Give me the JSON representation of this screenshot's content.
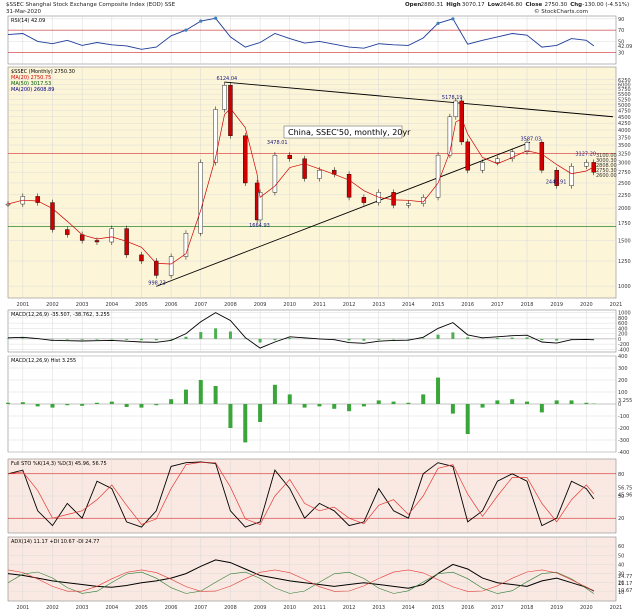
{
  "header": {
    "symbol": "$SSEC Shanghai Stock Exchange Composite Index (EOD) SSE",
    "date": "31-Mar-2020",
    "ohlc": [
      {
        "k": "Open",
        "v": "2880.31"
      },
      {
        "k": "High",
        "v": "3070.17"
      },
      {
        "k": "Low",
        "v": "2646.80"
      },
      {
        "k": "Close",
        "v": "2750.30"
      },
      {
        "k": "Chg",
        "v": "-130.00 (-4.51%)"
      }
    ],
    "brand": "© StockCharts.com"
  },
  "chart_data": [
    {
      "type": "line",
      "panel": "rsi",
      "legend": "RSI(14) 42.09",
      "ylim": [
        10,
        95
      ],
      "ticks": [
        30,
        50,
        70,
        90
      ],
      "last_label": "42.09",
      "x": [
        2000.5,
        2001,
        2001.5,
        2002,
        2002.5,
        2003,
        2003.5,
        2004,
        2004.5,
        2005,
        2005.5,
        2006,
        2006.5,
        2007,
        2007.5,
        2008,
        2008.5,
        2009,
        2009.5,
        2010,
        2010.5,
        2011,
        2011.5,
        2012,
        2012.5,
        2013,
        2013.5,
        2014,
        2014.5,
        2015,
        2015.5,
        2016,
        2016.5,
        2017,
        2017.5,
        2018,
        2018.5,
        2019,
        2019.5,
        2020,
        2020.25
      ],
      "values": [
        62,
        64,
        50,
        46,
        52,
        43,
        48,
        44,
        42,
        36,
        40,
        60,
        70,
        86,
        91,
        58,
        40,
        48,
        64,
        55,
        47,
        50,
        45,
        40,
        38,
        46,
        44,
        43,
        56,
        82,
        90,
        45,
        52,
        58,
        64,
        61,
        40,
        43,
        55,
        52,
        42
      ]
    },
    {
      "type": "bar",
      "panel": "price",
      "legend": "$SSEC (Monthly) 2750.30",
      "subtitle": "China, SSEC'50, monthly, 20yr",
      "scale": "log",
      "ylim": [
        900,
        7000
      ],
      "ticks": [
        1000,
        1250,
        1500,
        1750,
        2000,
        2250,
        2500,
        2750,
        3000,
        3250,
        3500,
        3750,
        4000,
        4250,
        4500,
        4750,
        5000,
        5250,
        5500,
        5750,
        6000,
        6250
      ],
      "x_ticks": [
        "2001",
        "2002",
        "2003",
        "2004",
        "2005",
        "2006",
        "2007",
        "2008",
        "2009",
        "2010",
        "2011",
        "2012",
        "2013",
        "2014",
        "2015",
        "2016",
        "2017",
        "2018",
        "2019",
        "2020",
        "2021"
      ],
      "legend_lines": [
        {
          "text": "MA(20) 2750.75",
          "color": "#d00000"
        },
        {
          "text": "MA(50) 3017.53",
          "color": "#006000"
        },
        {
          "text": "MA(200) 2608.89",
          "color": "#000080"
        }
      ],
      "x": [
        2000.5,
        2001,
        2001.5,
        2002,
        2002.5,
        2003,
        2003.5,
        2004,
        2004.5,
        2005,
        2005.5,
        2006,
        2006.5,
        2007,
        2007.5,
        2007.8,
        2008,
        2008.5,
        2008.9,
        2009,
        2009.5,
        2010,
        2010.5,
        2011,
        2011.5,
        2012,
        2012.5,
        2013,
        2013.5,
        2014,
        2014.5,
        2015,
        2015.4,
        2015.6,
        2015.8,
        2016,
        2016.5,
        2017,
        2017.5,
        2018,
        2018.5,
        2019,
        2019.5,
        2020,
        2020.25
      ],
      "values": [
        2073,
        2218,
        2100,
        1653,
        1580,
        1500,
        1480,
        1667,
        1320,
        1250,
        1100,
        1300,
        1600,
        3000,
        4800,
        5954,
        3800,
        2500,
        1800,
        2300,
        3200,
        3100,
        2600,
        2800,
        2700,
        2200,
        2100,
        2300,
        2050,
        2080,
        2200,
        3200,
        4500,
        5178,
        3600,
        2800,
        3000,
        3100,
        3300,
        3587,
        2800,
        2440,
        2900,
        3000,
        2750
      ],
      "annotations": [
        {
          "x": 2007.8,
          "y": 6124,
          "text": "6124.04"
        },
        {
          "x": 2015.4,
          "y": 5178,
          "text": "5178.19"
        },
        {
          "x": 2009.5,
          "y": 3478,
          "text": "3478.01"
        },
        {
          "x": 2018.05,
          "y": 3587,
          "text": "3587.03"
        },
        {
          "x": 2019.9,
          "y": 3127,
          "text": "3127.20"
        },
        {
          "x": 2005.5,
          "y": 998,
          "text": "998.23"
        },
        {
          "x": 2008.9,
          "y": 1664,
          "text": "1664.93"
        },
        {
          "x": 2018.9,
          "y": 2440,
          "text": "2440.91"
        }
      ],
      "price_labels": [
        "3100.00",
        "3000.30",
        "2808.00",
        "2750.30",
        "2600.00"
      ]
    },
    {
      "type": "line",
      "panel": "macd",
      "legend": "MACD(12,26,9) -35.507, -38.762, 3.255",
      "ylim": [
        -500,
        1100
      ],
      "ticks": [
        -400,
        -200,
        0,
        200,
        400,
        600,
        800,
        1000
      ],
      "x": [
        2000.5,
        2001,
        2001.5,
        2002,
        2002.5,
        2003,
        2003.5,
        2004,
        2004.5,
        2005,
        2005.5,
        2006,
        2006.5,
        2007,
        2007.5,
        2008,
        2008.5,
        2009,
        2009.5,
        2010,
        2010.5,
        2011,
        2011.5,
        2012,
        2012.5,
        2013,
        2013.5,
        2014,
        2014.5,
        2015,
        2015.5,
        2016,
        2016.5,
        2017,
        2017.5,
        2018,
        2018.5,
        2019,
        2019.5,
        2020,
        2020.25
      ],
      "values": [
        40,
        60,
        10,
        -60,
        -70,
        -80,
        -70,
        -60,
        -90,
        -120,
        -130,
        -60,
        200,
        650,
        1000,
        700,
        50,
        -350,
        -120,
        80,
        40,
        0,
        -30,
        -140,
        -170,
        -90,
        -60,
        -50,
        60,
        400,
        620,
        150,
        40,
        80,
        120,
        140,
        -120,
        -160,
        -30,
        -20,
        -35
      ]
    },
    {
      "type": "bar",
      "panel": "macd_hist",
      "legend": "MACD(12,26,9) Hist 3.255",
      "ylim": [
        -400,
        400
      ],
      "ticks": [
        -400,
        -300,
        -200,
        -100,
        0,
        100,
        200,
        300,
        400
      ],
      "last_label": "3.255",
      "x": [
        2000.5,
        2001,
        2001.5,
        2002,
        2002.5,
        2003,
        2003.5,
        2004,
        2004.5,
        2005,
        2005.5,
        2006,
        2006.5,
        2007,
        2007.5,
        2008,
        2008.5,
        2009,
        2009.5,
        2010,
        2010.5,
        2011,
        2011.5,
        2012,
        2012.5,
        2013,
        2013.5,
        2014,
        2014.5,
        2015,
        2015.5,
        2016,
        2016.5,
        2017,
        2017.5,
        2018,
        2018.5,
        2019,
        2019.5,
        2020,
        2020.25
      ],
      "values": [
        10,
        15,
        -20,
        -30,
        -10,
        -15,
        10,
        20,
        -25,
        -30,
        -10,
        40,
        120,
        200,
        150,
        -200,
        -320,
        -150,
        160,
        80,
        -30,
        -20,
        -40,
        -60,
        -20,
        30,
        20,
        10,
        80,
        220,
        -80,
        -250,
        -30,
        30,
        40,
        20,
        -70,
        30,
        30,
        10,
        3
      ]
    },
    {
      "type": "line",
      "panel": "stoch",
      "legend": "Full STO %K(14,3) %D(3) 45.96, 56.75",
      "ylim": [
        0,
        100
      ],
      "ticks": [
        20,
        50,
        80
      ],
      "last_labels": [
        "56.75",
        "45.96"
      ],
      "x": [
        2000.5,
        2001,
        2001.5,
        2002,
        2002.5,
        2003,
        2003.5,
        2004,
        2004.5,
        2005,
        2005.5,
        2006,
        2006.5,
        2007,
        2007.5,
        2008,
        2008.5,
        2009,
        2009.5,
        2010,
        2010.5,
        2011,
        2011.5,
        2012,
        2012.5,
        2013,
        2013.5,
        2014,
        2014.5,
        2015,
        2015.5,
        2016,
        2016.5,
        2017,
        2017.5,
        2018,
        2018.5,
        2019,
        2019.5,
        2020,
        2020.25
      ],
      "values": [
        80,
        85,
        30,
        10,
        40,
        20,
        70,
        60,
        15,
        8,
        30,
        90,
        95,
        96,
        94,
        30,
        8,
        15,
        85,
        60,
        20,
        40,
        30,
        10,
        15,
        60,
        30,
        20,
        80,
        95,
        90,
        15,
        30,
        70,
        80,
        70,
        10,
        20,
        70,
        60,
        46
      ]
    },
    {
      "type": "line",
      "panel": "adx",
      "legend": "ADX(14) 11.17 +DI 10.67 -DI 24.77",
      "ylim": [
        0,
        70
      ],
      "ticks": [
        10,
        20,
        30,
        40,
        50,
        60
      ],
      "last_labels": [
        "24.77",
        "11.17",
        "10.67"
      ],
      "x": [
        2000.5,
        2001,
        2001.5,
        2002,
        2002.5,
        2003,
        2003.5,
        2004,
        2004.5,
        2005,
        2005.5,
        2006,
        2006.5,
        2007,
        2007.5,
        2008,
        2008.5,
        2009,
        2009.5,
        2010,
        2010.5,
        2011,
        2011.5,
        2012,
        2012.5,
        2013,
        2013.5,
        2014,
        2014.5,
        2015,
        2015.5,
        2016,
        2016.5,
        2017,
        2017.5,
        2018,
        2018.5,
        2019,
        2019.5,
        2020,
        2020.25
      ],
      "values": [
        30,
        28,
        25,
        22,
        20,
        18,
        16,
        15,
        17,
        20,
        22,
        25,
        30,
        38,
        45,
        42,
        35,
        28,
        25,
        22,
        20,
        18,
        16,
        18,
        20,
        18,
        16,
        14,
        18,
        30,
        40,
        35,
        25,
        20,
        18,
        16,
        22,
        25,
        20,
        15,
        11
      ]
    }
  ]
}
